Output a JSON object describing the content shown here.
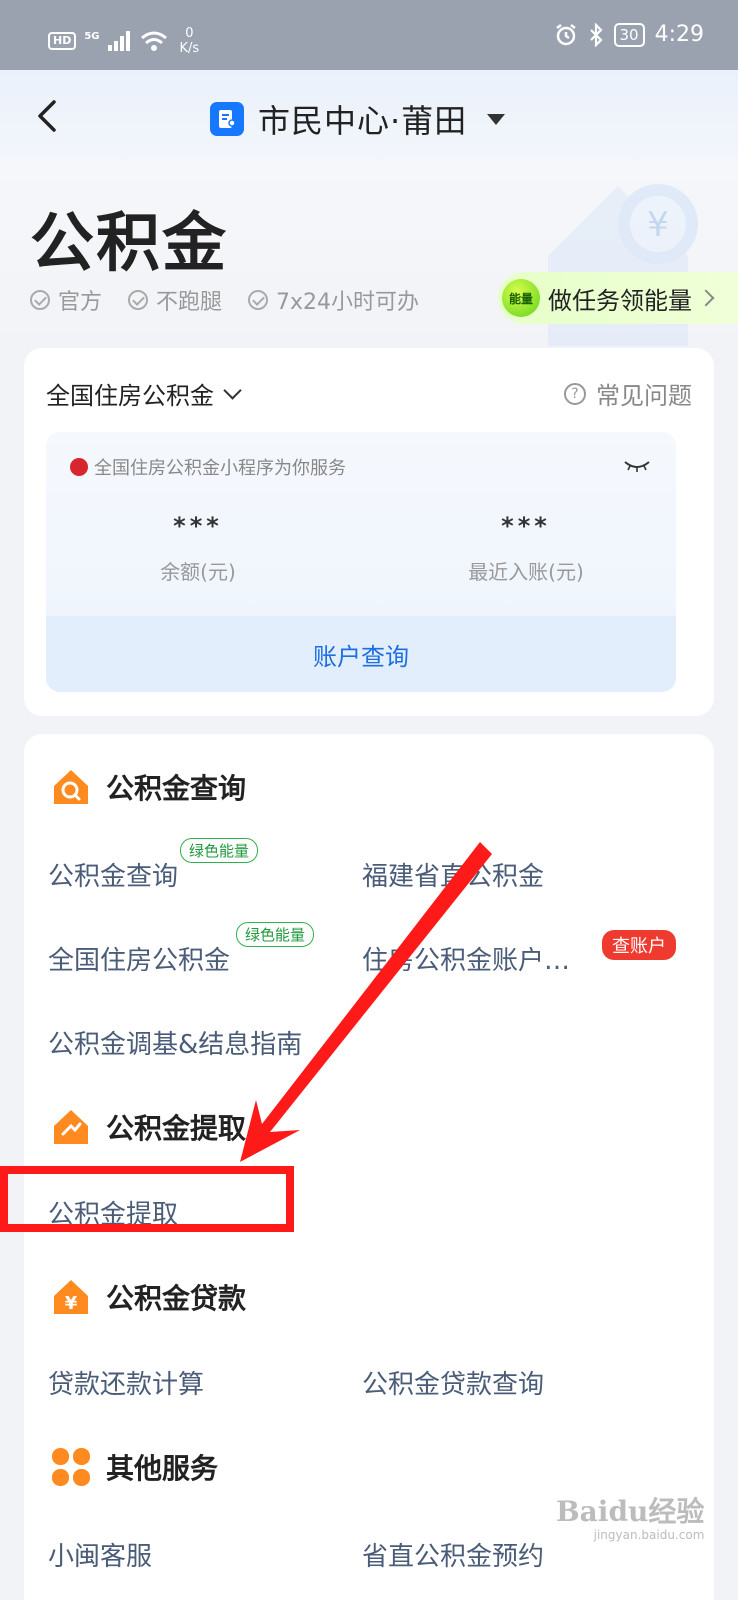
{
  "status_bar": {
    "hd": "HD",
    "network": "5G",
    "speed_value": "0",
    "speed_unit": "K/s",
    "battery": "30",
    "time": "4:29"
  },
  "nav": {
    "title": "市民中心·莆田"
  },
  "hero": {
    "title": "公积金",
    "tags": [
      "官方",
      "不跑腿",
      "7x24小时可办"
    ],
    "energy_ball": "能量",
    "energy_text": "做任务领能量"
  },
  "account": {
    "selector": "全国住房公积金",
    "faq": "常见问题",
    "mini_note": "全国住房公积金小程序为你服务",
    "balance_value": "***",
    "balance_label": "余额(元)",
    "recent_value": "***",
    "recent_label": "最近入账(元)",
    "query_button": "账户查询"
  },
  "sections": {
    "query": {
      "title": "公积金查询",
      "links": [
        "公积金查询",
        "福建省直公积金",
        "全国住房公积金",
        "住房公积金账户…",
        "公积金调基&结息指南"
      ],
      "badge_green": "绿色能量",
      "badge_red": "查账户"
    },
    "withdraw": {
      "title": "公积金提取",
      "links": [
        "公积金提取"
      ]
    },
    "loan": {
      "title": "公积金贷款",
      "links": [
        "贷款还款计算",
        "公积金贷款查询"
      ]
    },
    "other": {
      "title": "其他服务",
      "links": [
        "小闽客服",
        "省直公积金预约"
      ]
    }
  },
  "watermark": {
    "main": "Baidu经验",
    "sub": "jingyan.baidu.com"
  },
  "colors": {
    "link": "#4a5c78",
    "accent_blue": "#1677ff",
    "orange_icon": "#ff8a1f",
    "annotation_red": "#ff1a1a"
  }
}
